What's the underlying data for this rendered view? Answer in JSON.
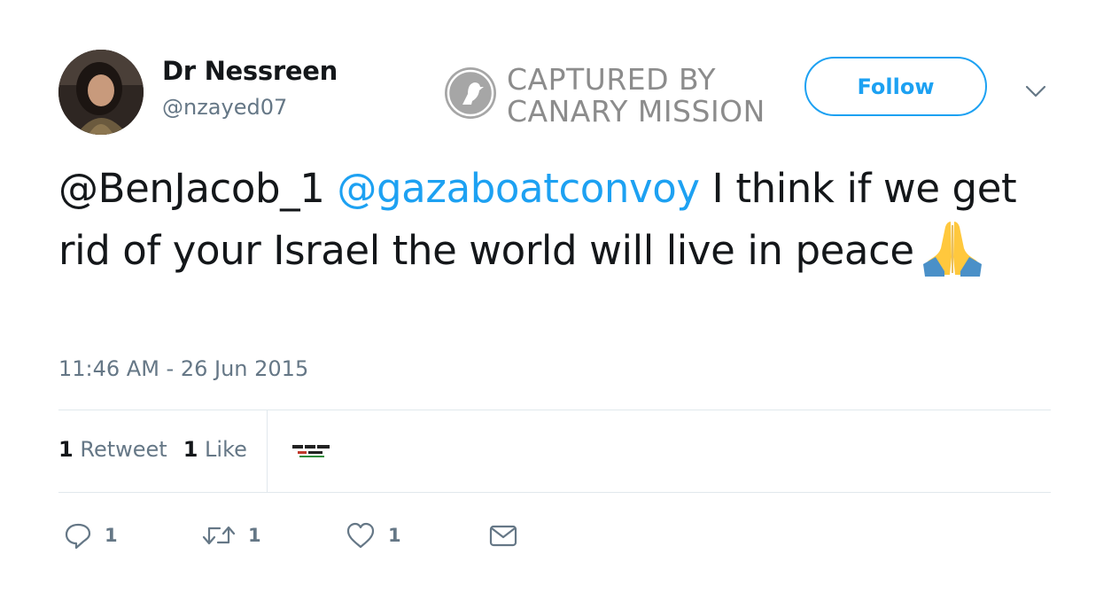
{
  "user": {
    "name": "Dr Nessreen",
    "handle": "@nzayed07",
    "avatar_icon": "profile-photo"
  },
  "watermark": {
    "line1": "CAPTURED BY",
    "line2": "CANARY MISSION",
    "logo_icon": "canary-bird-icon"
  },
  "follow_button": {
    "label": "Follow"
  },
  "menu_caret_icon": "chevron-down-icon",
  "tweet": {
    "mention1": "@BenJacob_1",
    "mention2": "@gazaboatconvoy",
    "text": " I think if we get rid of your Israel the world will live in peace",
    "emoji": "folded-hands-emoji",
    "timestamp": "11:46 AM - 26 Jun 2015"
  },
  "stats": {
    "retweets_count": "1",
    "retweets_label": "Retweet",
    "likes_count": "1",
    "likes_label": "Like",
    "liker_avatar": "Gaza Boat Convoy logo"
  },
  "actions": {
    "reply": {
      "icon": "reply-icon",
      "count": "1"
    },
    "retweet": {
      "icon": "retweet-icon",
      "count": "1"
    },
    "like": {
      "icon": "heart-icon",
      "count": "1"
    },
    "dm": {
      "icon": "envelope-icon"
    }
  },
  "colors": {
    "link": "#1da1f2",
    "secondary_text": "#657786",
    "divider": "#e1e8ed",
    "watermark": "#8c8c8c"
  }
}
